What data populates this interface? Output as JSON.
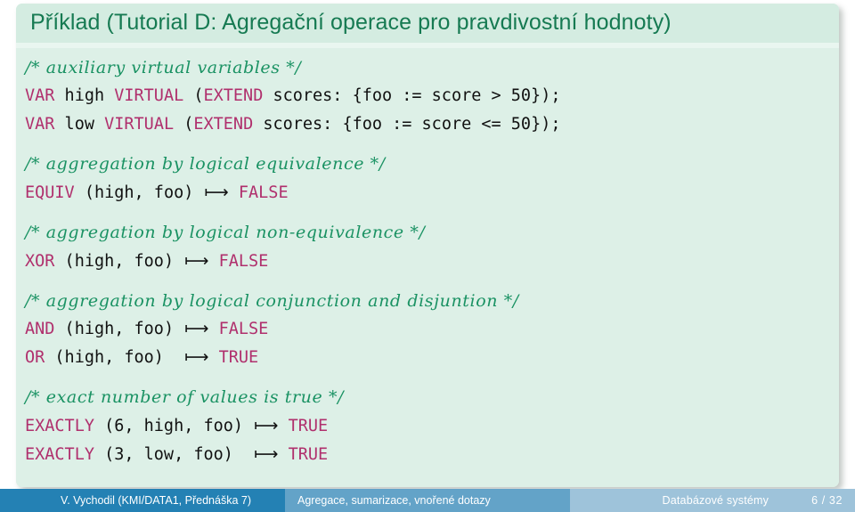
{
  "block": {
    "title": "Příklad (Tutorial D: Agregační operace pro pravdivostní hodnoty)",
    "colors": {
      "block_bg": "#ddf0e7",
      "block_title_bg": "#d4ece1",
      "title_text": "#167a52",
      "comment": "#1a9263",
      "keyword": "#b0306d",
      "plain": "#111111"
    },
    "code_lines": [
      {
        "type": "comment",
        "text": "/* auxiliary virtual variables */"
      },
      {
        "type": "code",
        "parts": [
          {
            "kind": "kw",
            "text": "VAR"
          },
          {
            "kind": "plain",
            "text": " high "
          },
          {
            "kind": "kw",
            "text": "VIRTUAL"
          },
          {
            "kind": "plain",
            "text": " ("
          },
          {
            "kind": "kw",
            "text": "EXTEND"
          },
          {
            "kind": "plain",
            "text": " scores: {foo := score > 50});"
          }
        ]
      },
      {
        "type": "code",
        "parts": [
          {
            "kind": "kw",
            "text": "VAR"
          },
          {
            "kind": "plain",
            "text": " low "
          },
          {
            "kind": "kw",
            "text": "VIRTUAL"
          },
          {
            "kind": "plain",
            "text": " ("
          },
          {
            "kind": "kw",
            "text": "EXTEND"
          },
          {
            "kind": "plain",
            "text": " scores: {foo := score <= 50});"
          }
        ]
      },
      {
        "type": "blank"
      },
      {
        "type": "comment",
        "text": "/* aggregation by logical equivalence */"
      },
      {
        "type": "code",
        "parts": [
          {
            "kind": "kw",
            "text": "EQUIV"
          },
          {
            "kind": "plain",
            "text": " (high, foo) "
          },
          {
            "kind": "arrow",
            "text": "⟼"
          },
          {
            "kind": "plain",
            "text": " "
          },
          {
            "kind": "kw",
            "text": "FALSE"
          }
        ]
      },
      {
        "type": "blank"
      },
      {
        "type": "comment",
        "text": "/* aggregation by logical non-equivalence */"
      },
      {
        "type": "code",
        "parts": [
          {
            "kind": "kw",
            "text": "XOR"
          },
          {
            "kind": "plain",
            "text": " (high, foo) "
          },
          {
            "kind": "arrow",
            "text": "⟼"
          },
          {
            "kind": "plain",
            "text": " "
          },
          {
            "kind": "kw",
            "text": "FALSE"
          }
        ]
      },
      {
        "type": "blank"
      },
      {
        "type": "comment",
        "text": "/* aggregation by logical conjunction and disjuntion */"
      },
      {
        "type": "code",
        "parts": [
          {
            "kind": "kw",
            "text": "AND"
          },
          {
            "kind": "plain",
            "text": " (high, foo) "
          },
          {
            "kind": "arrow",
            "text": "⟼"
          },
          {
            "kind": "plain",
            "text": " "
          },
          {
            "kind": "kw",
            "text": "FALSE"
          }
        ]
      },
      {
        "type": "code",
        "parts": [
          {
            "kind": "kw",
            "text": "OR"
          },
          {
            "kind": "plain",
            "text": " (high, foo)  "
          },
          {
            "kind": "arrow",
            "text": "⟼"
          },
          {
            "kind": "plain",
            "text": " "
          },
          {
            "kind": "kw",
            "text": "TRUE"
          }
        ]
      },
      {
        "type": "blank"
      },
      {
        "type": "comment",
        "text": "/* exact number of values is true */"
      },
      {
        "type": "code",
        "parts": [
          {
            "kind": "kw",
            "text": "EXACTLY"
          },
          {
            "kind": "plain",
            "text": " (6, high, foo) "
          },
          {
            "kind": "arrow",
            "text": "⟼"
          },
          {
            "kind": "plain",
            "text": " "
          },
          {
            "kind": "kw",
            "text": "TRUE"
          }
        ]
      },
      {
        "type": "code",
        "parts": [
          {
            "kind": "kw",
            "text": "EXACTLY"
          },
          {
            "kind": "plain",
            "text": " (3, low, foo)  "
          },
          {
            "kind": "arrow",
            "text": "⟼"
          },
          {
            "kind": "plain",
            "text": " "
          },
          {
            "kind": "kw",
            "text": "TRUE"
          }
        ]
      }
    ]
  },
  "footer": {
    "author": "V. Vychodil  (KMI/DATA1, Přednáška 7)",
    "section": "Agregace, sumarizace, vnořené dotazy",
    "presentation_title": "Databázové systémy",
    "page": "6 / 32",
    "colors": {
      "author_bg": "#2481b4",
      "section_bg": "#63a3c8",
      "meta_bg": "#9ec3da"
    }
  }
}
